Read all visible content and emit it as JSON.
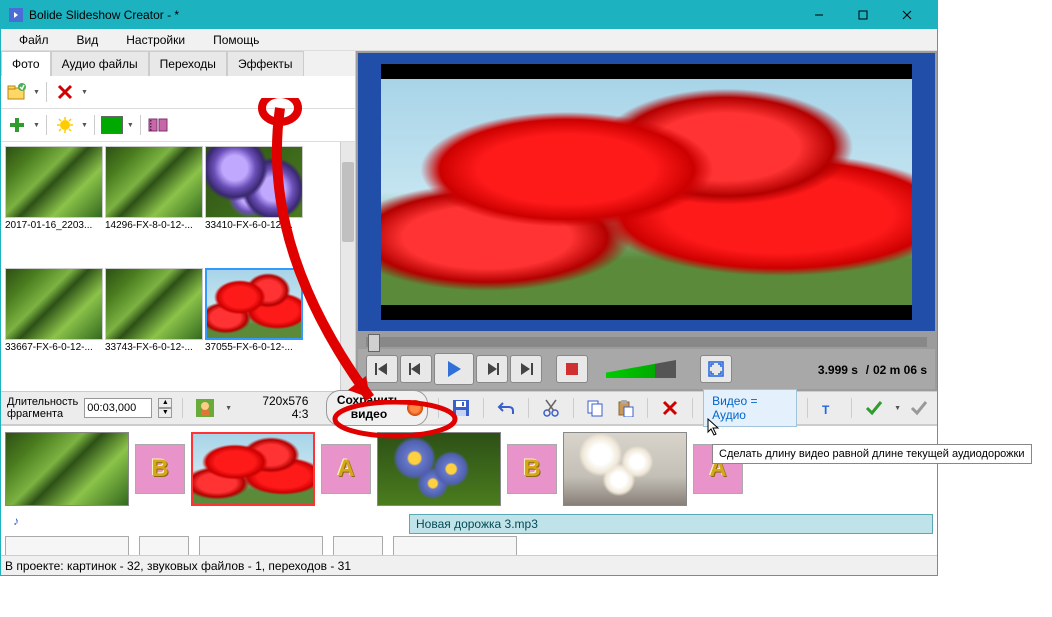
{
  "title": "Bolide Slideshow Creator - *",
  "menu": {
    "file": "Файл",
    "view": "Вид",
    "settings": "Настройки",
    "help": "Помощь"
  },
  "tabs": {
    "photo": "Фото",
    "audio": "Аудио файлы",
    "transitions": "Переходы",
    "effects": "Эффекты"
  },
  "thumbs": [
    {
      "label": "2017-01-16_2203..."
    },
    {
      "label": "14296-FX-8-0-12-..."
    },
    {
      "label": "33410-FX-6-0-12-..."
    },
    {
      "label": "33667-FX-6-0-12-..."
    },
    {
      "label": "33743-FX-6-0-12-..."
    },
    {
      "label": "37055-FX-6-0-12-..."
    }
  ],
  "duration": {
    "label": "Длительность\nфрагмента",
    "value": "00:03,000"
  },
  "preview_size": {
    "res": "720x576",
    "ratio": "4:3"
  },
  "save": {
    "line1": "Сохранить",
    "line2": "видео"
  },
  "vaeq": "Видео = Аудио",
  "tooltip": "Сделать длину видео равной длине текущей аудиодорожки",
  "time": {
    "current": "3.999 s",
    "sep": "/",
    "total": "02 m 06 s"
  },
  "transition_letter_b": "B",
  "transition_letter_a": "A",
  "audio": {
    "track": "Новая дорожка 3.mp3"
  },
  "status": "В проекте: картинок - 32, звуковых файлов - 1, переходов - 31"
}
